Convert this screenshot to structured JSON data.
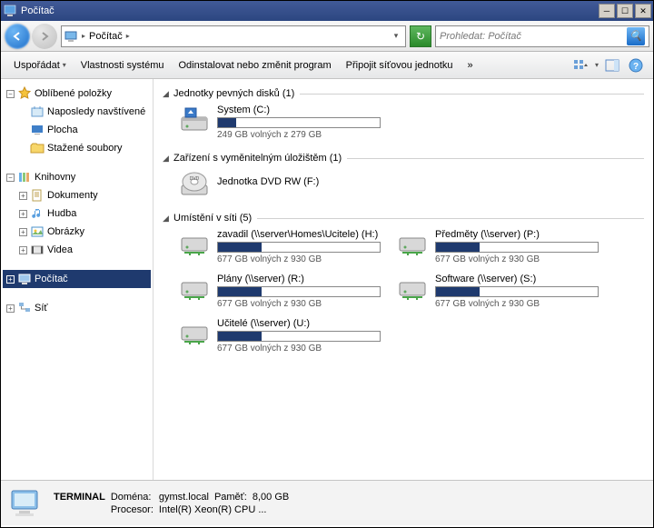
{
  "title": "Počítač",
  "breadcrumb": {
    "label": "Počítač"
  },
  "search": {
    "placeholder": "Prohledat: Počítač"
  },
  "toolbar": {
    "organize": "Uspořádat",
    "props": "Vlastnosti systému",
    "uninstall": "Odinstalovat nebo změnit program",
    "mapdrive": "Připojit síťovou jednotku",
    "more": "»"
  },
  "sidebar": {
    "favorites": "Oblíbené položky",
    "recent": "Naposledy navštívené",
    "desktop": "Plocha",
    "downloads": "Stažené soubory",
    "libraries": "Knihovny",
    "documents": "Dokumenty",
    "music": "Hudba",
    "pictures": "Obrázky",
    "videos": "Videa",
    "computer": "Počítač",
    "network": "Síť"
  },
  "groups": {
    "hdd": {
      "title": "Jednotky pevných disků (1)"
    },
    "removable": {
      "title": "Zařízení s vyměnitelným úložištěm (1)"
    },
    "network": {
      "title": "Umístění v síti (5)"
    }
  },
  "drives": {
    "system": {
      "name": "System (C:)",
      "free": "249 GB volných z 279 GB",
      "pct": 11
    },
    "dvd": {
      "name": "Jednotka DVD RW (F:)"
    },
    "zavadil": {
      "name": "zavadil (\\\\server\\Homes\\Ucitele) (H:)",
      "free": "677 GB volných z 930 GB",
      "pct": 27
    },
    "predmety": {
      "name": "Předměty (\\\\server) (P:)",
      "free": "677 GB volných z 930 GB",
      "pct": 27
    },
    "plany": {
      "name": "Plány (\\\\server) (R:)",
      "free": "677 GB volných z 930 GB",
      "pct": 27
    },
    "software": {
      "name": "Software (\\\\server) (S:)",
      "free": "677 GB volných z 930 GB",
      "pct": 27
    },
    "ucitele": {
      "name": "Učitelé (\\\\server) (U:)",
      "free": "677 GB volných z 930 GB",
      "pct": 27
    }
  },
  "status": {
    "name": "TERMINAL",
    "domain_label": "Doména:",
    "domain": "gymst.local",
    "mem_label": "Paměť:",
    "mem": "8,00 GB",
    "cpu_label": "Procesor:",
    "cpu": "Intel(R) Xeon(R) CPU   ..."
  }
}
